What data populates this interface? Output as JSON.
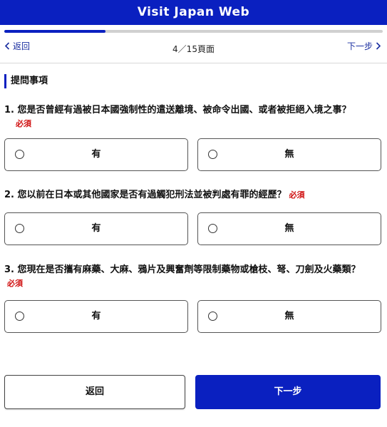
{
  "header": {
    "title": "Visit Japan Web"
  },
  "progress": {
    "current_page": 4,
    "total_pages": 15,
    "fraction": 0.2667
  },
  "nav": {
    "back_label": "返回",
    "page_indicator": "4／15頁面",
    "next_label": "下一步"
  },
  "section": {
    "title": "提問事項"
  },
  "questions": [
    {
      "text": "1. 您是否曾經有過被日本國強制性的遣送離境、被命令出國、或者被拒絕入境之事？",
      "required": "必須",
      "option_yes": "有",
      "option_no": "無"
    },
    {
      "text": "2. 您以前在日本或其他國家是否有過觸犯刑法並被判處有罪的經歷？",
      "required": "必須",
      "option_yes": "有",
      "option_no": "無"
    },
    {
      "text": "3. 您現在是否攜有麻藥、大麻、鴉片及興奮劑等限制藥物或槍枝、弩、刀劍及火藥類？",
      "required": "必須",
      "option_yes": "有",
      "option_no": "無"
    }
  ],
  "footer": {
    "back_label": "返回",
    "next_label": "下一步"
  },
  "colors": {
    "brand": "#0a20c0",
    "required": "#d01010"
  }
}
